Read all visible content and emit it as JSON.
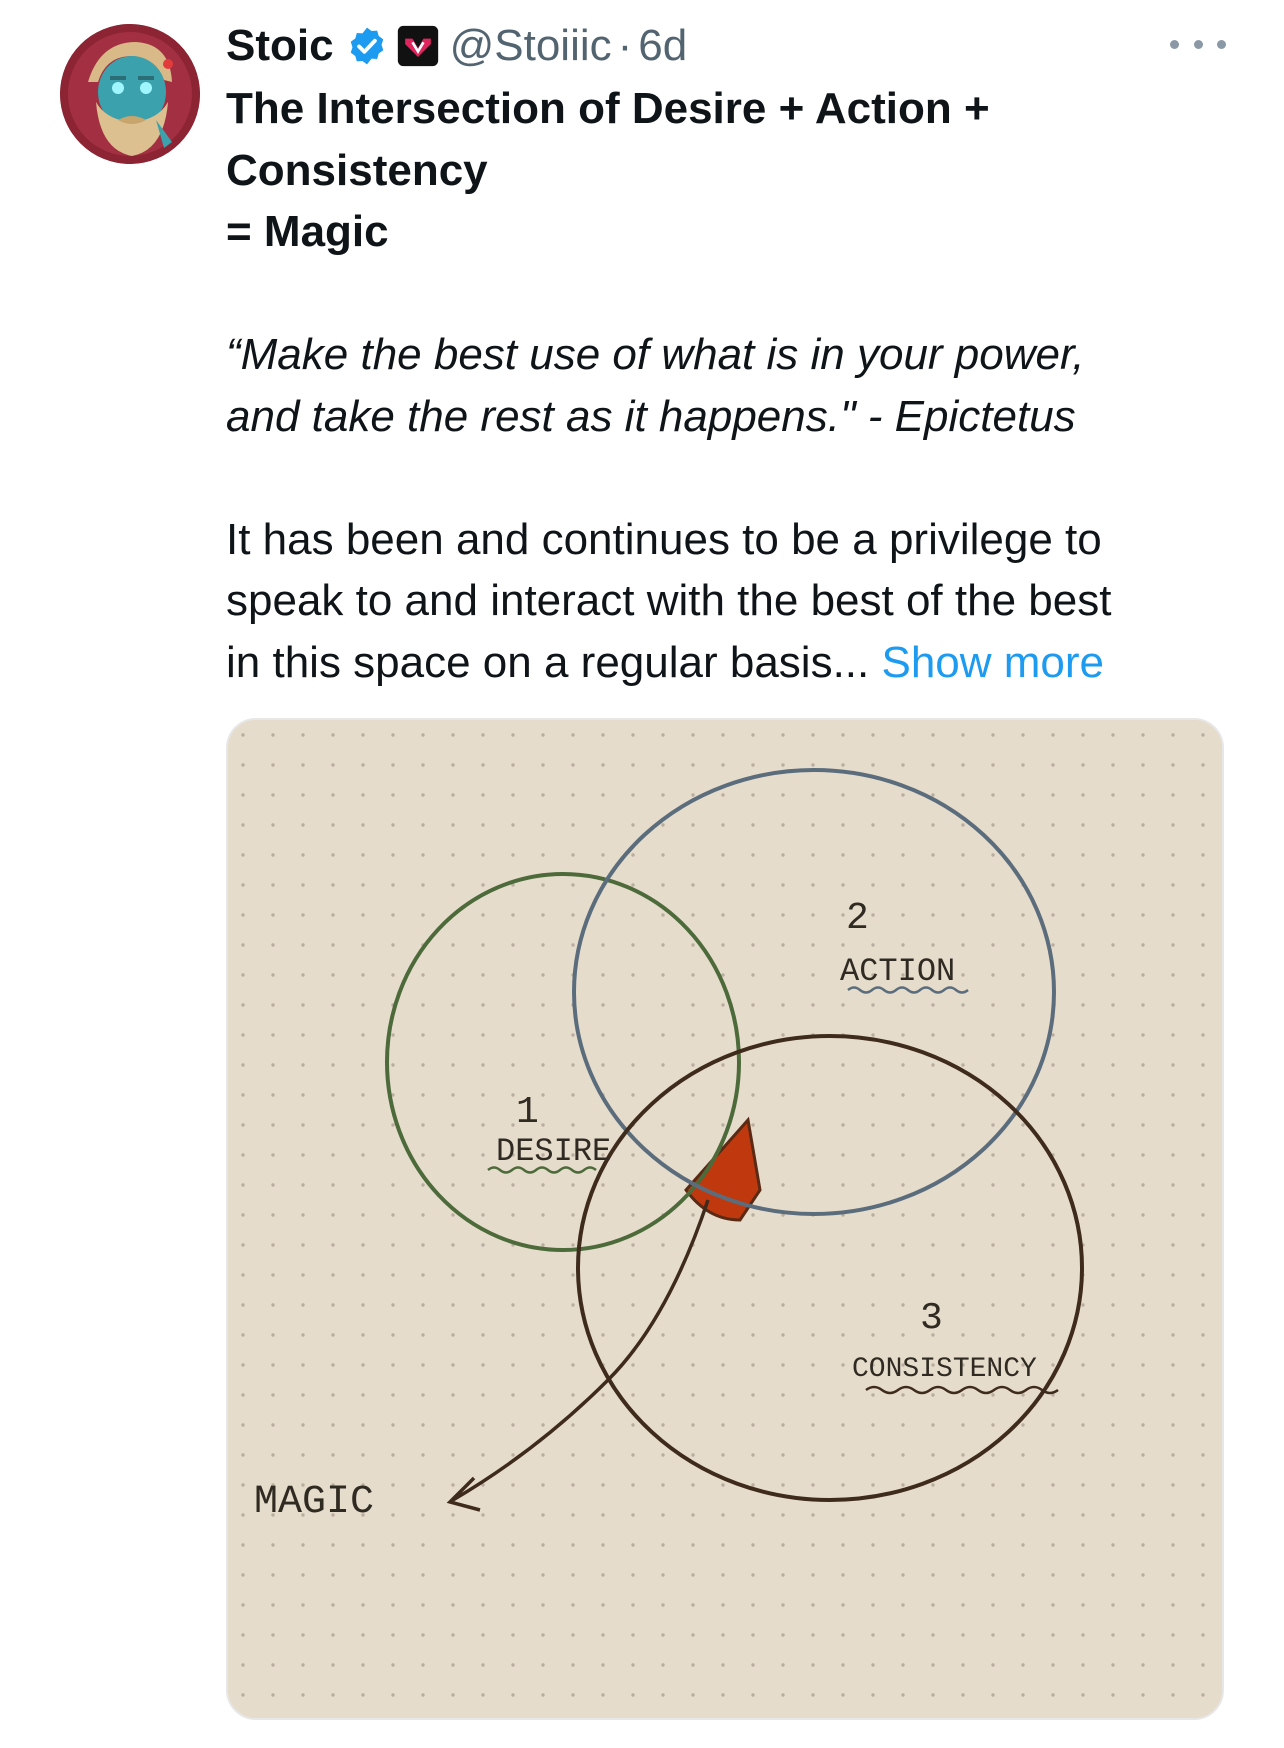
{
  "tweet": {
    "author": {
      "display_name": "Stoic",
      "handle": "@Stoiiic",
      "separator": "·",
      "time": "6d",
      "avatar": "bearded-blue-face-avatar",
      "verified_icon": "verified-badge-icon",
      "affiliation_icon": "affiliate-badge-icon"
    },
    "more_icon": "more-options-icon",
    "text": {
      "title_line1": "The Intersection of  Desire + Action +",
      "title_line2": "Consistency",
      "title_line3": "= Magic",
      "quote_line1": "“Make the best use of what is in your power,",
      "quote_line2": "and take the rest as it happens.\" - Epictetus",
      "body_line1": "It has been and continues to be a privilege to",
      "body_line2": "speak to and interact with the best of the best",
      "body_line3": "in this space on a regular basis...",
      "show_more": "Show more"
    },
    "media": {
      "type": "hand-drawn venn diagram on dotted paper",
      "labels": {
        "desire_num": "1",
        "desire": "DESIRE",
        "action_num": "2",
        "action": "ACTION",
        "consistency_num": "3",
        "consistency": "CONSISTENCY",
        "magic": "MAGIC"
      }
    },
    "colors": {
      "verified": "#1d9bf0",
      "link": "#1d9bf0",
      "secondary_text": "#536471",
      "paper": "#e6dccc",
      "magic_fill": "#c0390e"
    }
  }
}
